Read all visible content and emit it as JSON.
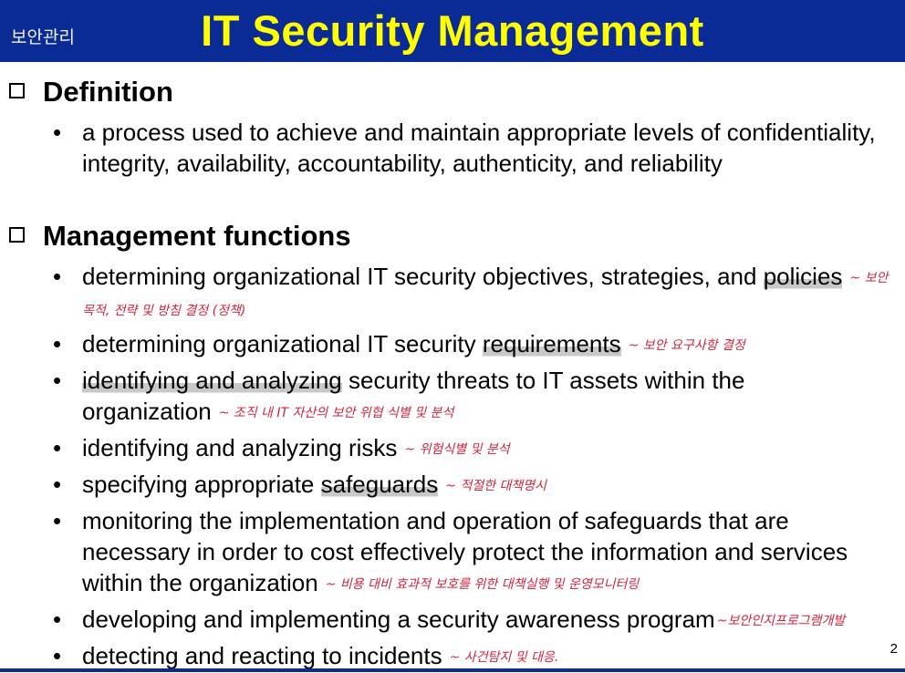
{
  "header": {
    "corner_label": "보안관리",
    "title": "IT Security Management"
  },
  "definition": {
    "title": "Definition",
    "item": "a process used to achieve and maintain appropriate levels of confidentiality, integrity, availability, accountability, authenticity, and reliability"
  },
  "functions": {
    "title": "Management functions",
    "items": [
      {
        "text": "determining organizational IT security objectives, strategies, and",
        "hl": "policies",
        "note": "~ 보안 목적, 전략 및 방침 결정 (정책)"
      },
      {
        "pre": "determining organizational IT security ",
        "hl": "requirements",
        "note": "~ 보안 요구사항 결정"
      },
      {
        "hl": "identifying and analyzing",
        "post": " security threats to IT assets within the organization",
        "note": "~ 조직 내 IT 자산의 보안 위협 식별 및 분석"
      },
      {
        "text": "identifying and analyzing risks",
        "note": "~ 위험식별 및 분석"
      },
      {
        "pre": "specifying appropriate ",
        "hl": "safeguards",
        "note": "~ 적절한 대책명시"
      },
      {
        "text": "monitoring the implementation and operation of safeguards that are necessary in order to cost effectively protect the information and services within the organization",
        "note": "~ 비용 대비 효과적 보호를 위한 대책실행 및 운영모니터링"
      },
      {
        "text": "developing and implementing a security awareness program",
        "note": "~보안인지프로그램개발"
      },
      {
        "text": "detecting and reacting to incidents",
        "note": "~ 사건탐지 및 대응."
      }
    ]
  },
  "footer": {
    "page_number": "2"
  },
  "colors": {
    "header_bg": "#0a2a96",
    "title": "#ffff00",
    "annotation": "#d2233c"
  }
}
